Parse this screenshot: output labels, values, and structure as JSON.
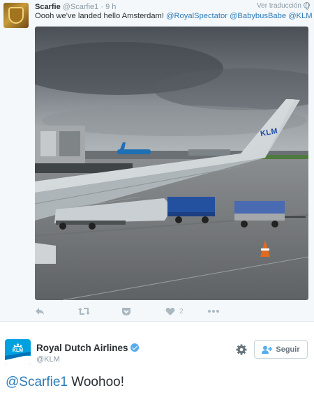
{
  "tweet": {
    "author_name": "Scarfie",
    "author_handle": "@Scarfie1",
    "separator": "·",
    "time": "9 h",
    "translate_label": "Ver traducción",
    "text_plain": "Oooh we've landed hello Amsterdam! ",
    "mentions": [
      "@RoyalSpectator",
      "@BabybusBabe",
      "@KLM"
    ],
    "photo_wing_logo": "KLM",
    "actions": {
      "reply_icon": "reply-icon",
      "retweet_icon": "retweet-icon",
      "pocket_icon": "pocket-icon",
      "like_icon": "heart-icon",
      "like_count": "2",
      "more_icon": "more-icon"
    }
  },
  "reply": {
    "author_name": "Royal Dutch Airlines",
    "author_handle": "@KLM",
    "avatar_logo": "KLM",
    "follow_label": "Seguir",
    "mention": "@Scarfie1",
    "text": " Woohoo!"
  },
  "colors": {
    "link": "#2b7bb9",
    "muted": "#8899a6",
    "verified": "#55acee",
    "klm_blue": "#00a1de",
    "tweet_bg": "#f5f8fa"
  }
}
